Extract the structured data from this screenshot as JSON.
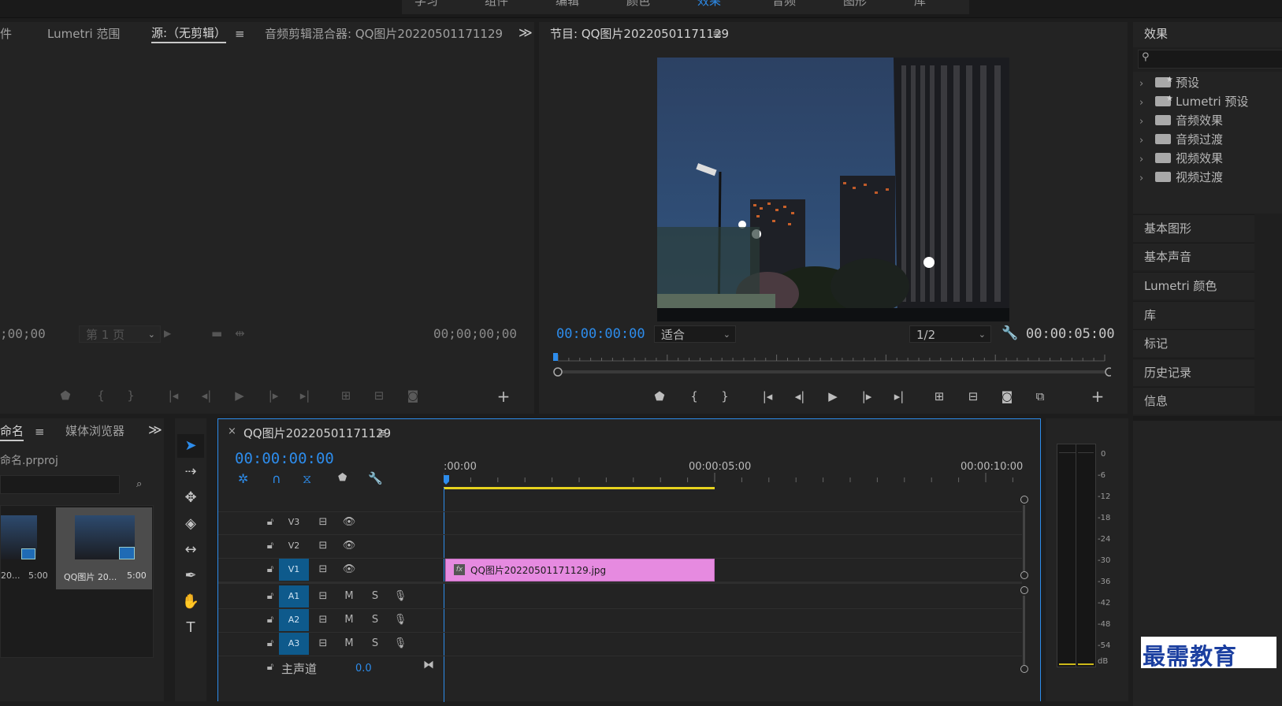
{
  "top_menu": [
    "学习",
    "组件",
    "编辑",
    "颜色",
    "效果",
    "音频",
    "图形",
    "库"
  ],
  "source_panel": {
    "tabs": [
      "件",
      "Lumetri 范围",
      "源:（无剪辑）",
      "音频剪辑混合器: QQ图片20220501171129"
    ],
    "overflow": "≫",
    "timecode_left": ";00;00",
    "page_select": "第 1 页",
    "timecode_right": "00;00;00;00"
  },
  "program_panel": {
    "title": "节目: QQ图片20220501171129",
    "timecode_current": "00:00:00:00",
    "fit": "适合",
    "resolution": "1/2",
    "timecode_duration": "00:00:05:00"
  },
  "effects_panel": {
    "title": "效果",
    "search_placeholder": "",
    "folders": [
      {
        "label": "预设",
        "icon": "preset-folder-icon"
      },
      {
        "label": "Lumetri 预设",
        "icon": "preset-folder-icon"
      },
      {
        "label": "音频效果",
        "icon": "folder-icon"
      },
      {
        "label": "音频过渡",
        "icon": "folder-icon"
      },
      {
        "label": "视频效果",
        "icon": "folder-icon"
      },
      {
        "label": "视频过渡",
        "icon": "folder-icon"
      }
    ],
    "sections": [
      "基本图形",
      "基本声音",
      "Lumetri 颜色",
      "库",
      "标记",
      "历史记录",
      "信息"
    ]
  },
  "project_panel": {
    "tabs": [
      "命名",
      "媒体浏览器"
    ],
    "project_file": "命名.prproj",
    "items": [
      {
        "name": "20...",
        "duration": "5:00"
      },
      {
        "name": "QQ图片 20...",
        "duration": "5:00"
      }
    ]
  },
  "timeline": {
    "sequence_name": "QQ图片20220501171129",
    "timecode": "00:00:00:00",
    "ruler_labels": [
      ":00:00",
      "00:00:05:00",
      "00:00:10:00"
    ],
    "video_tracks": [
      "V3",
      "V2",
      "V1"
    ],
    "audio_tracks": [
      "A1",
      "A2",
      "A3"
    ],
    "audio_buttons": {
      "mute": "M",
      "solo": "S"
    },
    "clip_name": "QQ图片20220501171129.jpg",
    "clip_badge": "fx",
    "master_label": "主声道",
    "master_value": "0.0"
  },
  "audio_meter": {
    "scale": [
      "0",
      "-6",
      "-12",
      "-18",
      "-24",
      "-30",
      "-36",
      "-42",
      "-48",
      "-54",
      "dB"
    ]
  },
  "watermark": "最需教育",
  "colors": {
    "accent_blue": "#2d8ceb",
    "clip_pink": "#e68ae0",
    "work_area_yellow": "#e6d21e",
    "track_target_blue": "#0e5a8c"
  }
}
